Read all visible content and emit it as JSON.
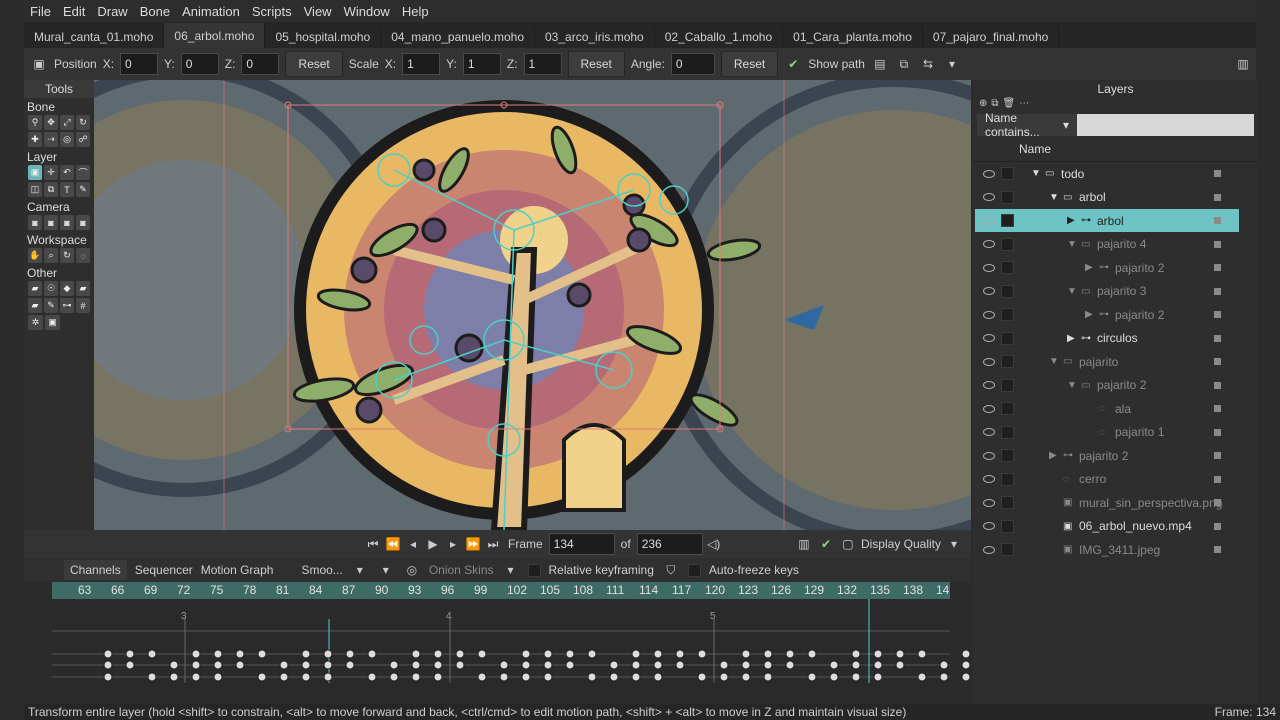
{
  "menu": [
    "File",
    "Edit",
    "Draw",
    "Bone",
    "Animation",
    "Scripts",
    "View",
    "Window",
    "Help"
  ],
  "tabs": [
    {
      "label": "Mural_canta_01.moho",
      "active": false
    },
    {
      "label": "06_arbol.moho",
      "active": true
    },
    {
      "label": "05_hospital.moho",
      "active": false
    },
    {
      "label": "04_mano_panuelo.moho",
      "active": false
    },
    {
      "label": "03_arco_iris.moho",
      "active": false
    },
    {
      "label": "02_Caballo_1.moho",
      "active": false
    },
    {
      "label": "01_Cara_planta.moho",
      "active": false
    },
    {
      "label": "07_pajaro_final.moho",
      "active": false
    }
  ],
  "toolbar": {
    "position_label": "Position",
    "x_label": "X:",
    "y_label": "Y:",
    "z_label": "Z:",
    "pos_x": "0",
    "pos_y": "0",
    "pos_z": "0",
    "reset_label": "Reset",
    "scale_label": "Scale",
    "scale_x": "1",
    "scale_y": "1",
    "scale_z": "1",
    "angle_label": "Angle:",
    "angle": "0",
    "show_path_label": "Show path"
  },
  "tools": {
    "title": "Tools",
    "sections": [
      "Bone",
      "Layer",
      "Camera",
      "Workspace",
      "Other"
    ]
  },
  "canvasbar": {
    "frame_label": "Frame",
    "frame": "134",
    "of_label": "of",
    "total": "236",
    "display_quality": "Display Quality"
  },
  "timeline": {
    "tabs": [
      "Channels",
      "Sequencer",
      "Motion Graph"
    ],
    "smooth": "Smoo...",
    "onion": "Onion Skins",
    "relative": "Relative keyframing",
    "autofreeze": "Auto-freeze keys",
    "ruler": [
      "63",
      "66",
      "69",
      "72",
      "75",
      "78",
      "81",
      "84",
      "87",
      "90",
      "93",
      "96",
      "99",
      "102",
      "105",
      "108",
      "111",
      "114",
      "117",
      "120",
      "123",
      "126",
      "129",
      "132",
      "135",
      "138",
      "14"
    ],
    "markers": [
      "3",
      "4",
      "5"
    ]
  },
  "layers": {
    "title": "Layers",
    "filter": "Name contains...",
    "name_header": "Name",
    "rows": [
      {
        "name": "todo",
        "indent": 0,
        "arrow": "▼",
        "icon": "folder",
        "dim": false,
        "sel": false
      },
      {
        "name": "arbol",
        "indent": 1,
        "arrow": "▼",
        "icon": "folder",
        "dim": false,
        "sel": false
      },
      {
        "name": "arbol",
        "indent": 2,
        "arrow": "▶",
        "icon": "bone",
        "dim": false,
        "sel": true
      },
      {
        "name": "pajarito 4",
        "indent": 2,
        "arrow": "▼",
        "icon": "folder",
        "dim": true,
        "sel": false
      },
      {
        "name": "pajarito 2",
        "indent": 3,
        "arrow": "▶",
        "icon": "bone",
        "dim": true,
        "sel": false
      },
      {
        "name": "pajarito 3",
        "indent": 2,
        "arrow": "▼",
        "icon": "folder",
        "dim": true,
        "sel": false
      },
      {
        "name": "pajarito 2",
        "indent": 3,
        "arrow": "▶",
        "icon": "bone",
        "dim": true,
        "sel": false
      },
      {
        "name": "circulos",
        "indent": 2,
        "arrow": "▶",
        "icon": "bone",
        "dim": false,
        "sel": false
      },
      {
        "name": "pajarito",
        "indent": 1,
        "arrow": "▼",
        "icon": "folder",
        "dim": true,
        "sel": false
      },
      {
        "name": "pajarito 2",
        "indent": 2,
        "arrow": "▼",
        "icon": "folder",
        "dim": true,
        "sel": false
      },
      {
        "name": "ala",
        "indent": 3,
        "arrow": "",
        "icon": "vector",
        "dim": true,
        "sel": false
      },
      {
        "name": "pajarito 1",
        "indent": 3,
        "arrow": "",
        "icon": "vector",
        "dim": true,
        "sel": false
      },
      {
        "name": "pajarito 2",
        "indent": 1,
        "arrow": "▶",
        "icon": "bone",
        "dim": true,
        "sel": false
      },
      {
        "name": "cerro",
        "indent": 1,
        "arrow": "",
        "icon": "vector",
        "dim": true,
        "sel": false
      },
      {
        "name": "mural_sin_perspectiva.png",
        "indent": 1,
        "arrow": "",
        "icon": "image",
        "dim": true,
        "sel": false
      },
      {
        "name": "06_arbol_nuevo.mp4",
        "indent": 1,
        "arrow": "",
        "icon": "image",
        "dim": false,
        "sel": false
      },
      {
        "name": "IMG_3411.jpeg",
        "indent": 1,
        "arrow": "",
        "icon": "image",
        "dim": true,
        "sel": false
      }
    ]
  },
  "status": {
    "message": "Transform entire layer (hold <shift> to constrain, <alt> to move forward and back, <ctrl/cmd> to edit motion path, <shift> + <alt> to move in Z and maintain visual size)",
    "frame": "Frame: 134"
  }
}
